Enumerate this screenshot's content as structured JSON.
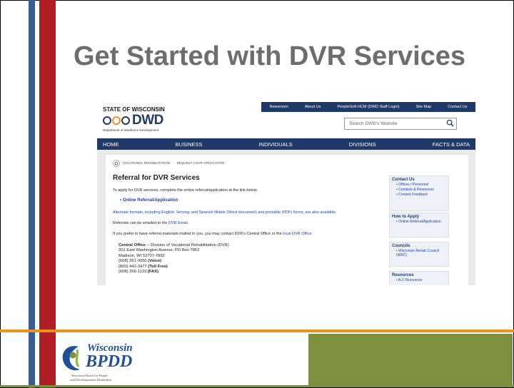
{
  "slide": {
    "title": "Get Started with DVR Services",
    "logo_name": "Wisconsin",
    "logo_abbr": "BPDD",
    "logo_subtitle_1": "Wisconsin Board for People",
    "logo_subtitle_2": "with Developmental Disabilities"
  },
  "site": {
    "state_label": "STATE OF WISCONSIN",
    "logo_text": "DWD",
    "department": "Department of Workforce Development",
    "top_nav": [
      "Newsroom",
      "About Us",
      "PeopleSoft HCM (DWD Staff Login)",
      "Site Map",
      "Contact Us"
    ],
    "search_placeholder": "Search DWD's Website",
    "main_nav": [
      "HOME",
      "BUSINESS",
      "INDIVIDUALS",
      "DIVISIONS",
      "FACTS & DATA"
    ],
    "breadcrumb": [
      "VOCATIONAL REHABILITATION",
      "REQUEST A DVR APPLICATION"
    ],
    "page_title": "Referral for DVR Services",
    "intro": "To apply for DVR services, complete the online referral/application at the link below.",
    "online_link": "Online Referral/Application",
    "alt_formats": "Alternate formats, including English, Hmong, and Spanish fillable (Word document) and printable (PDF) forms, are also available.",
    "email_text": "Referrals can be emailed to the",
    "email_link": "DVR Email.",
    "mail_text": "If you prefer to have referral materials mailed to you, you may contact DVR's Central Office or the",
    "mail_link": "local DVR Office:",
    "office": {
      "name": "Central Office",
      "division": " -- Division of Vocational Rehabilitation (DVR)",
      "address1": "201 East Washington Avenue, PO Box 7852",
      "address2": "Madison, WI 53707-7852",
      "phone1": "(608) 261-0050 ",
      "phone1_type": "(Voice)",
      "phone2": "(800) 442-3477 ",
      "phone2_type": "(Toll Free)",
      "phone3": "(608) 266-1133 ",
      "phone3_type": "(FAX)"
    },
    "sidebar": {
      "contact_title": "Contact Us",
      "contact_items": [
        "Offices / Personnel",
        "Contacts & Resources",
        "Content Feedback"
      ],
      "apply_title": "How to Apply",
      "apply_items": [
        "Online Referral/Application"
      ],
      "councils_title": "Councils",
      "councils_items": [
        "Wisconsin Rehab Council (WRC)"
      ],
      "resources_title": "Resources",
      "resources_items": [
        "A-Z Resources"
      ]
    }
  },
  "colors": {
    "navy": "#1f3a69",
    "red": "#b01e24",
    "orange": "#f0901f",
    "green": "#7e8f3d",
    "title_gray": "#6d6d6d"
  }
}
